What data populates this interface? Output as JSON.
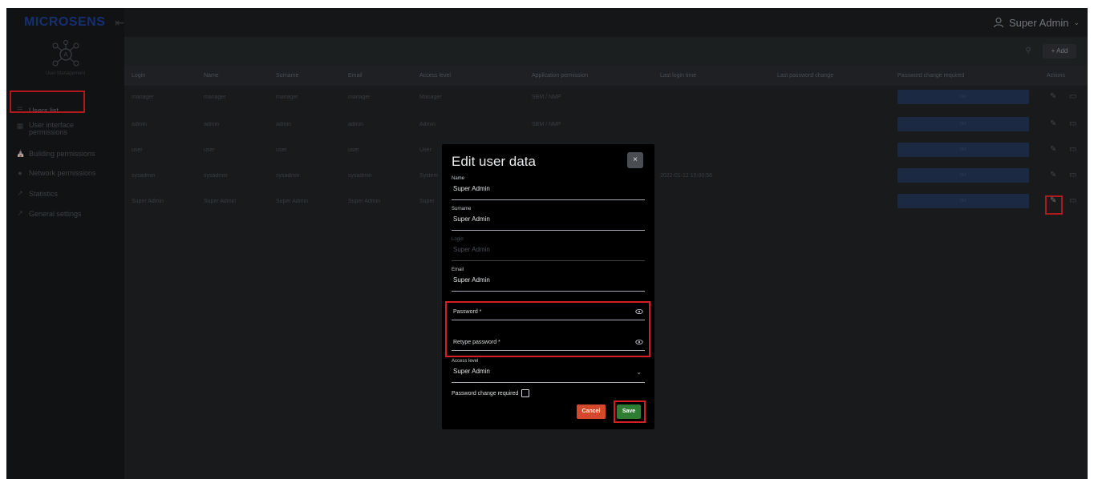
{
  "brand": {
    "name": "MICROSENS",
    "collapse_icon": "menu-collapse-icon"
  },
  "user_menu": {
    "name": "Super Admin"
  },
  "sidebar": {
    "module_label": "User Management",
    "items": [
      {
        "label": "Users list",
        "icon": "list-icon"
      },
      {
        "label": "User interface permissions",
        "icon": "interface-icon"
      },
      {
        "label": "Building permissions",
        "icon": "building-icon"
      },
      {
        "label": "Network permissions",
        "icon": "network-icon"
      },
      {
        "label": "Statistics",
        "icon": "chart-icon"
      },
      {
        "label": "General settings",
        "icon": "settings-icon"
      }
    ]
  },
  "toolbar": {
    "add_label": "+ Add"
  },
  "table": {
    "columns": [
      "Login",
      "Name",
      "Surname",
      "Email",
      "Access level",
      "Application permission",
      "Last login time",
      "Last password change",
      "Password change required",
      "Actions"
    ],
    "rows": [
      {
        "login": "manager",
        "name": "manager",
        "surname": "manager",
        "email": "manager",
        "access": "Manager",
        "app": "SBM / NMP",
        "last_login": "",
        "pw_required": "No"
      },
      {
        "login": "admin",
        "name": "admin",
        "surname": "admin",
        "email": "admin",
        "access": "Admin",
        "app": "SBM / NMP",
        "last_login": "",
        "pw_required": "No"
      },
      {
        "login": "user",
        "name": "user",
        "surname": "user",
        "email": "user",
        "access": "User",
        "app": "",
        "last_login": "",
        "pw_required": "No"
      },
      {
        "login": "sysadmin",
        "name": "sysadmin",
        "surname": "sysadmin",
        "email": "sysadmin",
        "access": "System",
        "app": "",
        "last_login": "2022-01-12 15:00:56",
        "pw_required": "No"
      },
      {
        "login": "Super Admin",
        "name": "Super Admin",
        "surname": "Super Admin",
        "email": "Super Admin",
        "access": "Super",
        "app": "",
        "last_login": "",
        "pw_required": "No"
      }
    ]
  },
  "modal": {
    "title": "Edit user data",
    "close_label": "×",
    "fields": {
      "name": {
        "label": "Name",
        "value": "Super Admin"
      },
      "surname": {
        "label": "Surname",
        "value": "Super Admin"
      },
      "login": {
        "label": "Login",
        "value": "Super Admin"
      },
      "email": {
        "label": "Email",
        "value": "Super Admin"
      },
      "password": {
        "label": "Password *"
      },
      "retype": {
        "label": "Retype password *"
      },
      "access": {
        "label": "Access level",
        "value": "Super Admin"
      }
    },
    "pw_change_required_label": "Password change required",
    "cancel_label": "Cancel",
    "save_label": "Save"
  },
  "colors": {
    "highlight": "#d61e24",
    "save": "#2e7d32",
    "cancel": "#d4492b",
    "pill": "#223252"
  }
}
